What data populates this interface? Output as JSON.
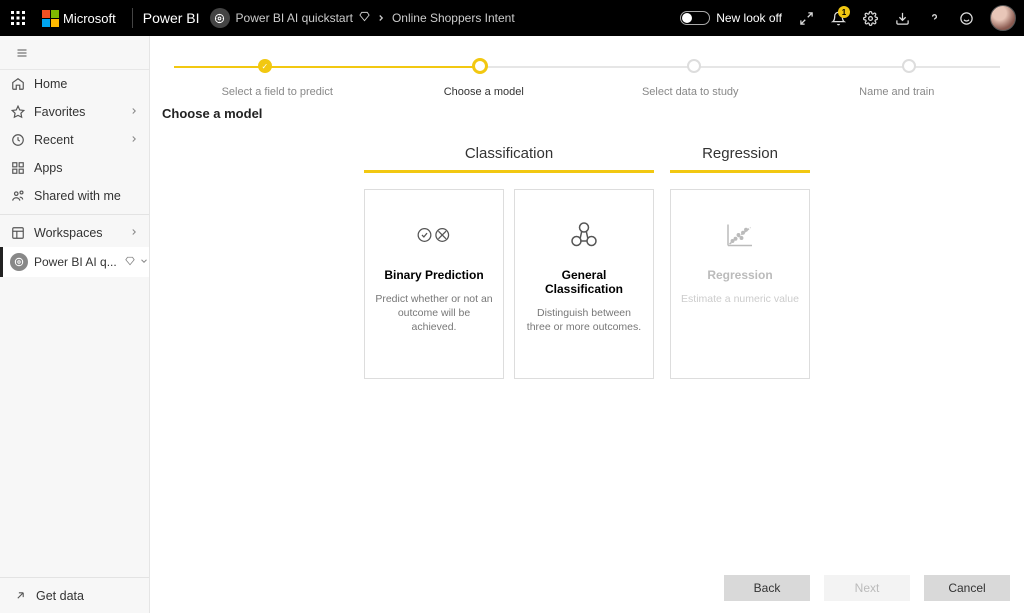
{
  "topbar": {
    "company": "Microsoft",
    "product": "Power BI",
    "breadcrumb": [
      "Power BI AI quickstart",
      "Online Shoppers Intent"
    ],
    "newlook": "New look off",
    "notif_count": "1"
  },
  "sidebar": {
    "items": [
      {
        "label": "Home"
      },
      {
        "label": "Favorites"
      },
      {
        "label": "Recent"
      },
      {
        "label": "Apps"
      },
      {
        "label": "Shared with me"
      },
      {
        "label": "Workspaces"
      }
    ],
    "active_workspace": "Power BI AI q...",
    "getdata": "Get data"
  },
  "stepper": {
    "steps": [
      {
        "label": "Select a field to predict"
      },
      {
        "label": "Choose a model"
      },
      {
        "label": "Select data to study"
      },
      {
        "label": "Name and train"
      }
    ],
    "active_index": 1
  },
  "page": {
    "heading": "Choose a model"
  },
  "categories": [
    {
      "title": "Classification",
      "cards": [
        {
          "title": "Binary Prediction",
          "desc": "Predict whether or not an outcome will be achieved.",
          "enabled": true,
          "icon": "binary"
        },
        {
          "title": "General Classification",
          "desc": "Distinguish between three or more outcomes.",
          "enabled": true,
          "icon": "cluster"
        }
      ]
    },
    {
      "title": "Regression",
      "cards": [
        {
          "title": "Regression",
          "desc": "Estimate a numeric value",
          "enabled": false,
          "icon": "scatter"
        }
      ]
    }
  ],
  "footer": {
    "back": "Back",
    "next": "Next",
    "cancel": "Cancel"
  }
}
